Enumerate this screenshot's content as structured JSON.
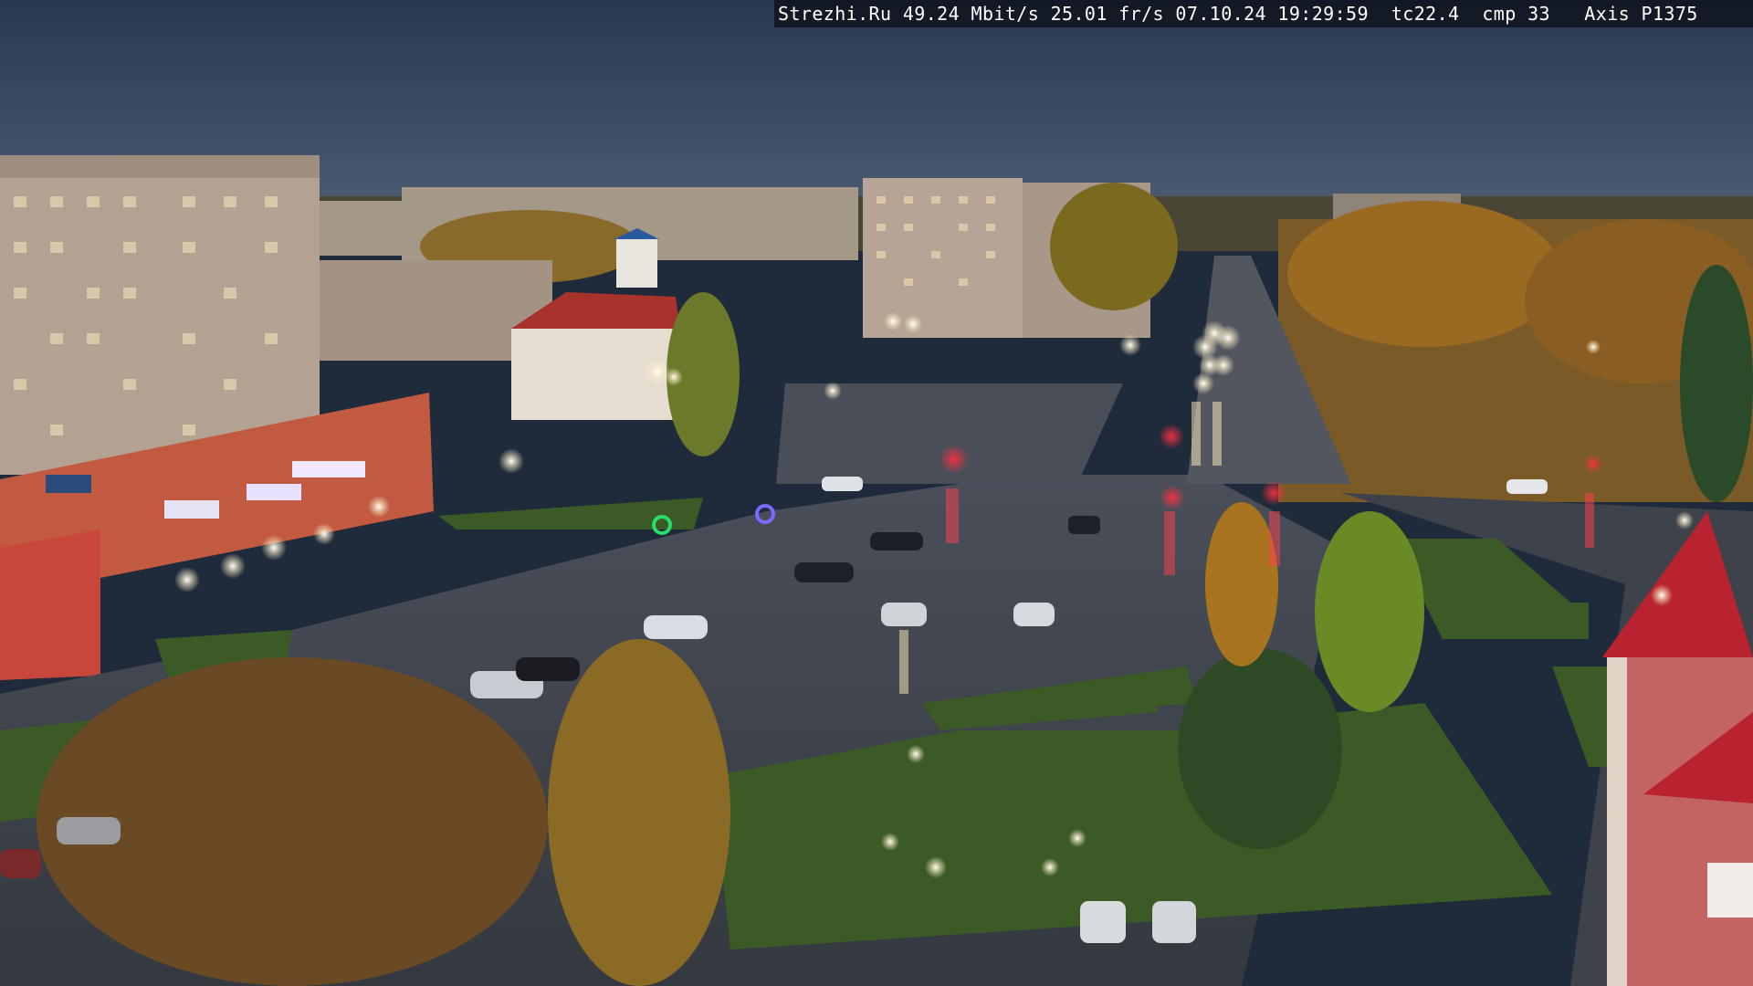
{
  "overlay": {
    "text": "Strezhi.Ru 49.24 Mbit/s 25.01 fr/s 07.10.24 19:29:59  tc22.4  cmp 33   Axis P1375"
  },
  "scene": {
    "description_colors": {
      "sky_top": "#2c3c55",
      "sky_horizon": "#4a5a72",
      "asphalt": "#3a3f4a",
      "grass": "#3f6a2a",
      "foliage_autumn": "#a8741f",
      "building_beige": "#b8a898",
      "building_red": "#c0503a"
    }
  }
}
